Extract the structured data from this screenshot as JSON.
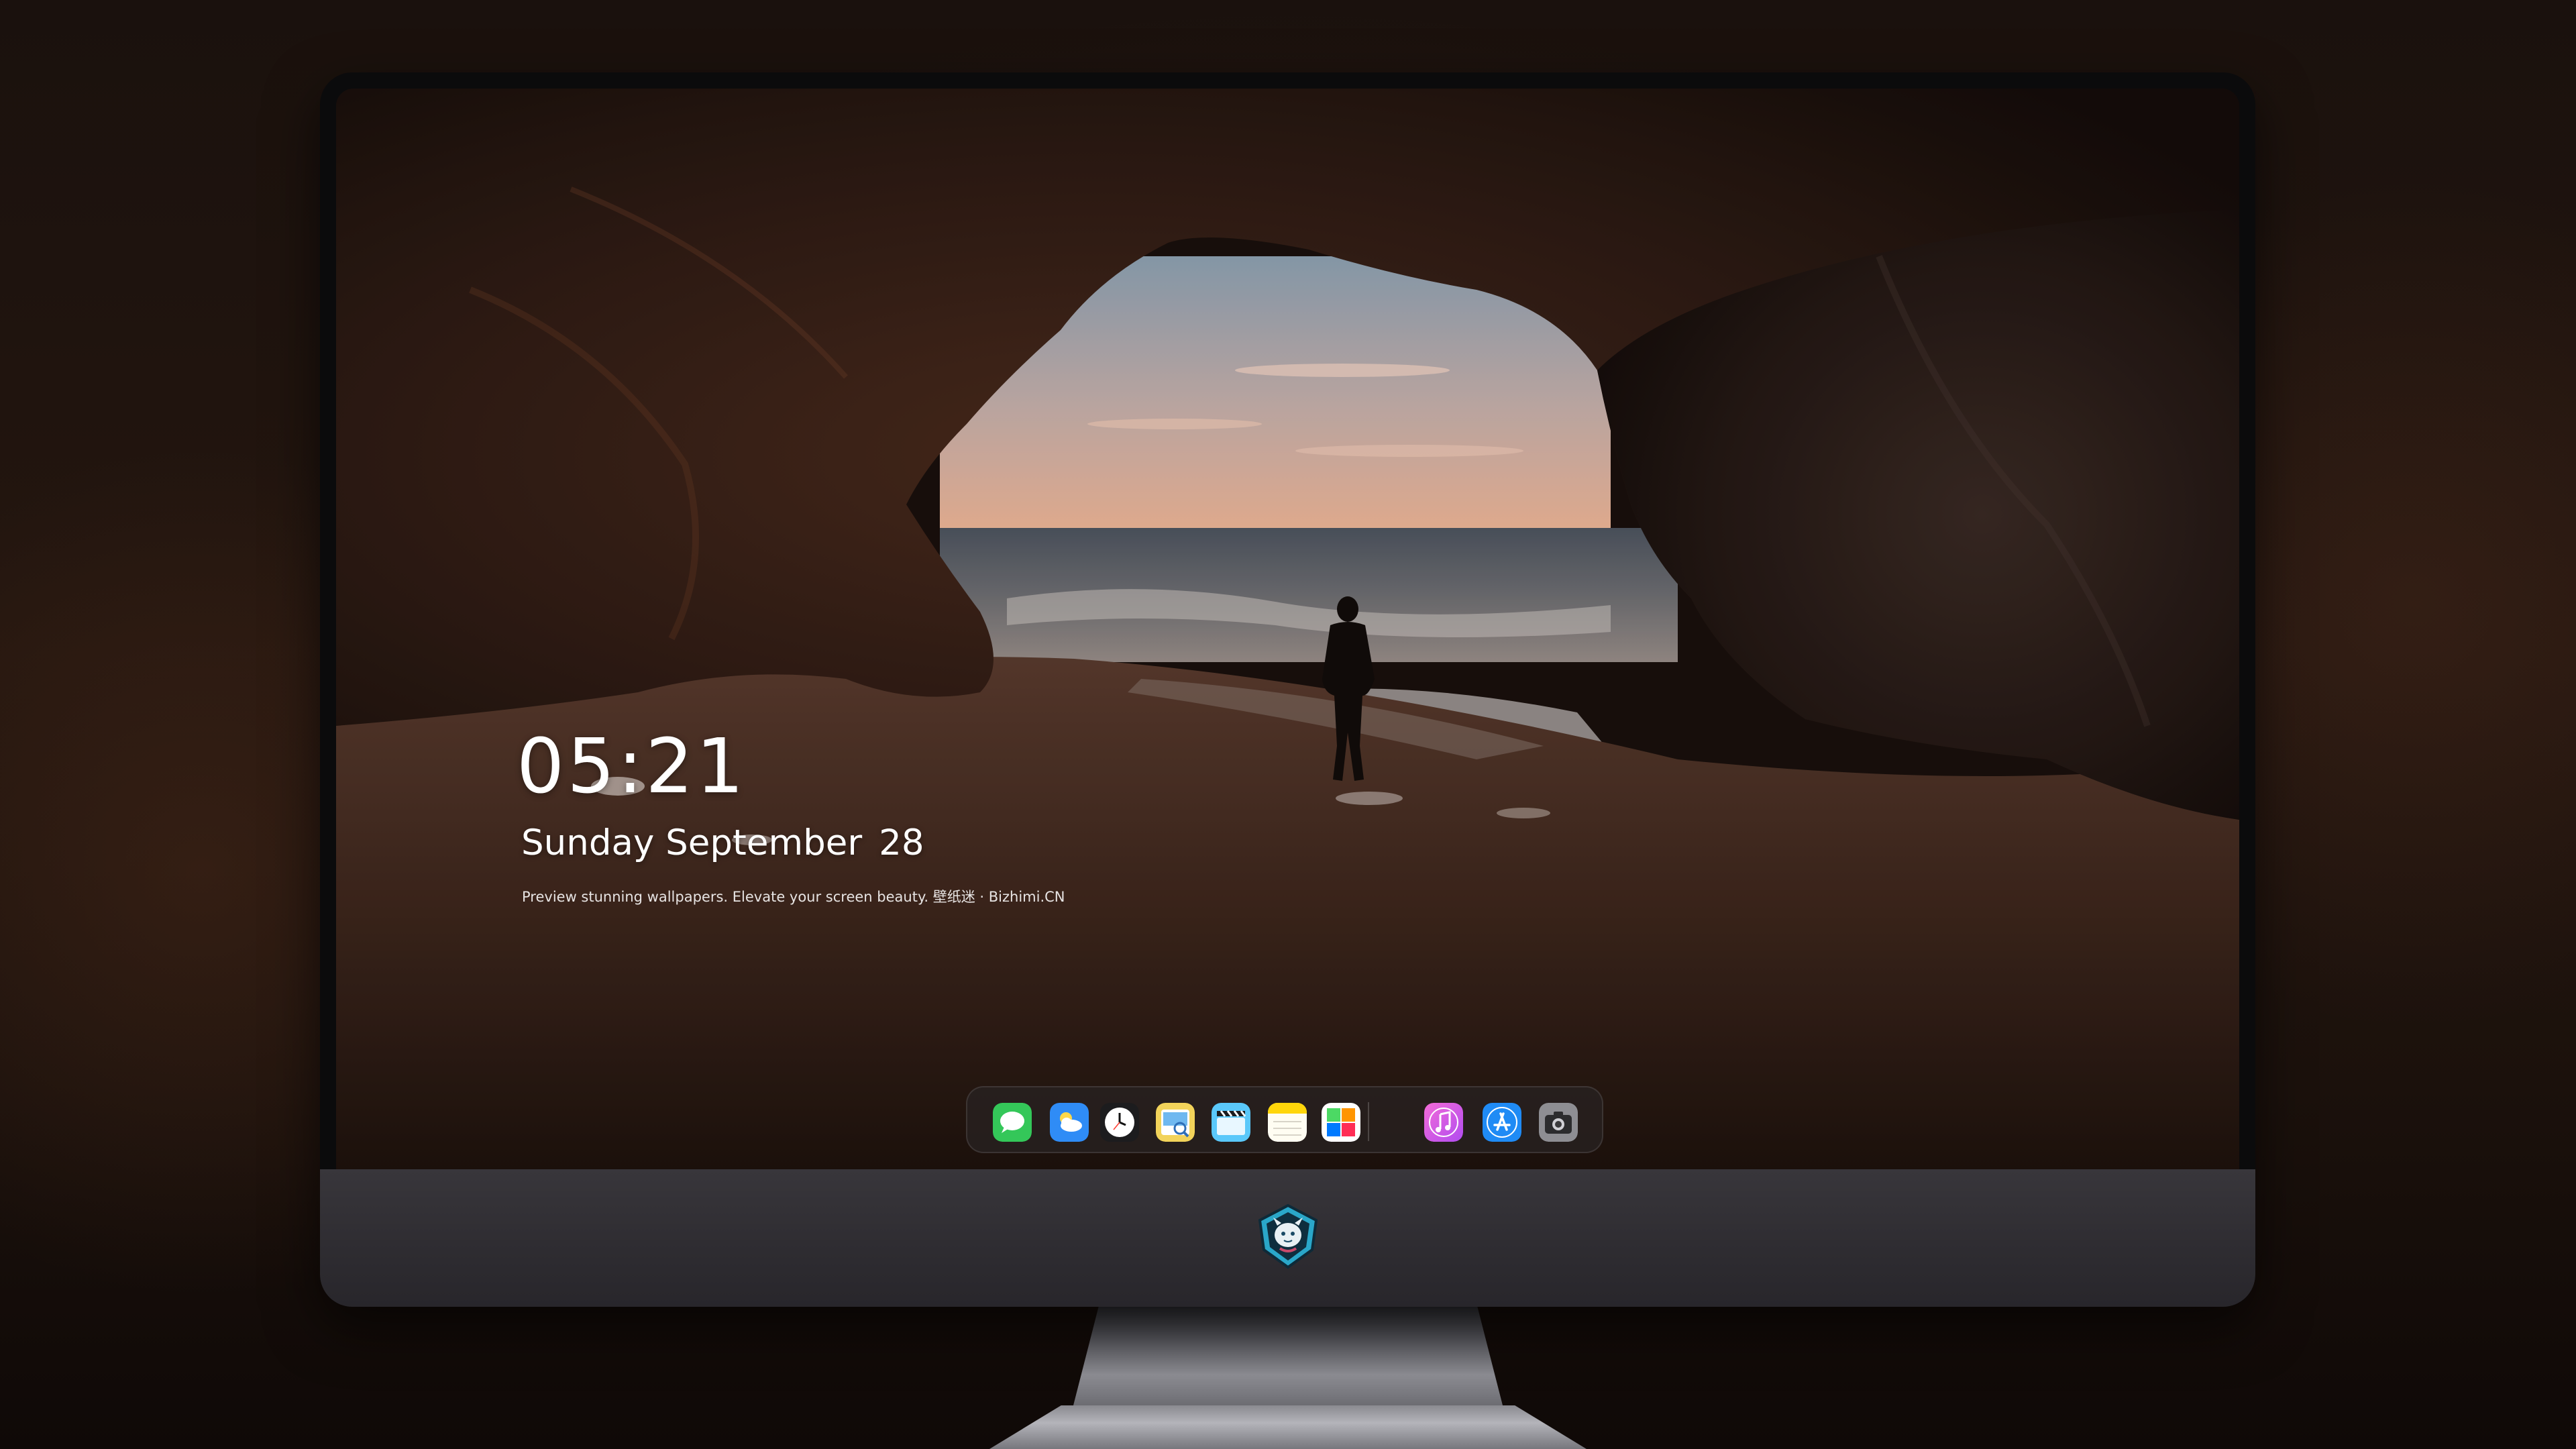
{
  "lock_screen": {
    "time": "05:21",
    "weekday_month": "Sunday September",
    "day": "28",
    "tagline": "Preview stunning wallpapers. Elevate your screen beauty. 壁纸迷 · Bizhimi.CN"
  },
  "dock": {
    "apps": [
      {
        "name": "Messages",
        "icon": "messages-icon",
        "color": "#34c759"
      },
      {
        "name": "Weather",
        "icon": "weather-icon",
        "color": "#2f8cf6"
      },
      {
        "name": "Clock",
        "icon": "clock-icon",
        "color": "#ffffff"
      },
      {
        "name": "Preview",
        "icon": "preview-icon",
        "color": "#f2d35a"
      },
      {
        "name": "Clips",
        "icon": "clapperboard-icon",
        "color": "#5ac8fa"
      },
      {
        "name": "Notes",
        "icon": "notes-icon",
        "color": "#ffd60a"
      },
      {
        "name": "Photo Booth",
        "icon": "photos-grid-icon",
        "color": "#ffffff"
      },
      {
        "name": "iTunes",
        "icon": "music-note-icon",
        "color": "#e85cf2"
      },
      {
        "name": "App Store",
        "icon": "app-store-icon",
        "color": "#1f8bf5"
      },
      {
        "name": "Camera",
        "icon": "camera-icon",
        "color": "#8e8e93"
      }
    ]
  },
  "monitor": {
    "chin_logo": "dragon-shield-logo"
  }
}
